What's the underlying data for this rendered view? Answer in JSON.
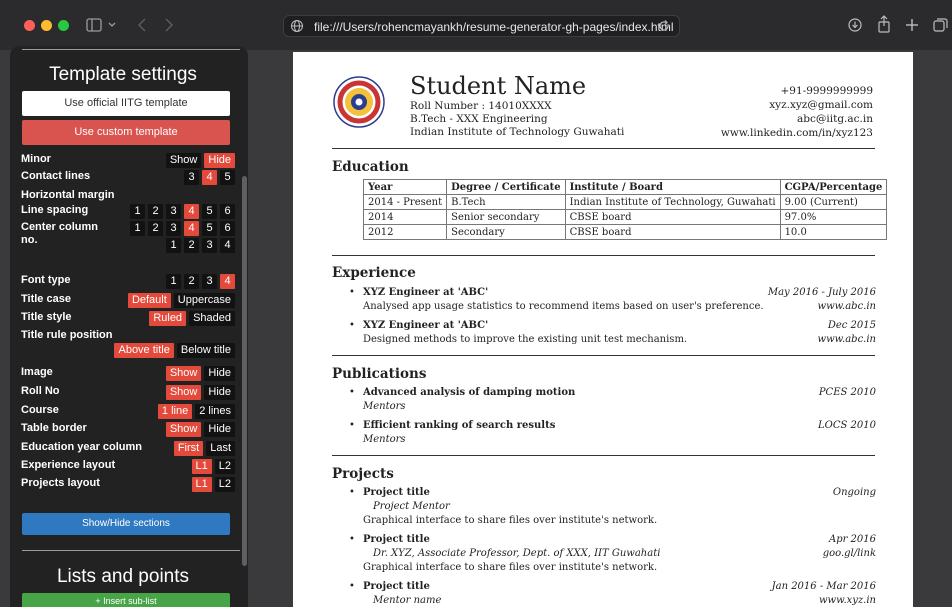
{
  "browser": {
    "url": "file:///Users/rohencmayankh/resume-generator-gh-pages/index.html"
  },
  "sidebar": {
    "template_settings_title": "Template settings",
    "official_btn": "Use official IITG template",
    "custom_btn": "Use custom template",
    "options": [
      {
        "label": "Minor",
        "choices": [
          "Show",
          "Hide"
        ],
        "selected": 1
      },
      {
        "label": "Contact lines",
        "choices": [
          "3",
          "4",
          "5"
        ],
        "selected": 1
      },
      {
        "label": "Horizontal margin",
        "choices": [],
        "selected": -1
      },
      {
        "label": "Line spacing",
        "choices": [
          "1",
          "2",
          "3",
          "4",
          "5",
          "6"
        ],
        "selected": 3
      },
      {
        "label": "Center column no.",
        "choices": [
          "1",
          "2",
          "3",
          "4",
          "5",
          "6"
        ],
        "selected": 3,
        "wrap": true
      },
      {
        "label": "",
        "choices": [
          "1",
          "2",
          "3",
          "4"
        ],
        "selected": -1
      },
      {
        "label": "Font type",
        "choices": [
          "1",
          "2",
          "3",
          "4"
        ],
        "selected": 3
      },
      {
        "label": "Title case",
        "choices": [
          "Default",
          "Uppercase"
        ],
        "selected": 0
      },
      {
        "label": "Title style",
        "choices": [
          "Ruled",
          "Shaded"
        ],
        "selected": 0
      },
      {
        "label": "Title rule position",
        "choices": [],
        "selected": -1
      },
      {
        "label": "",
        "choices": [
          "Above title",
          "Below title"
        ],
        "selected": 0
      },
      {
        "label": "Image",
        "choices": [
          "Show",
          "Hide"
        ],
        "selected": 0
      },
      {
        "label": "Roll No",
        "choices": [
          "Show",
          "Hide"
        ],
        "selected": 0
      },
      {
        "label": "Course",
        "choices": [
          "1 line",
          "2 lines"
        ],
        "selected": 0
      },
      {
        "label": "Table border",
        "choices": [
          "Show",
          "Hide"
        ],
        "selected": 0
      },
      {
        "label": "Education year column",
        "choices": [
          "First",
          "Last"
        ],
        "selected": 0
      },
      {
        "label": "Experience layout",
        "choices": [
          "L1",
          "L2"
        ],
        "selected": 0
      },
      {
        "label": "Projects layout",
        "choices": [
          "L1",
          "L2"
        ],
        "selected": 0
      }
    ],
    "show_hide_btn": "Show/Hide sections",
    "lists_title": "Lists and points",
    "insert_btn": "+ Insert sub-list",
    "accent_color": "#e34a3b"
  },
  "resume": {
    "name": "Student Name",
    "roll": "Roll Number : 14010XXXX",
    "course": "B.Tech - XXX Engineering",
    "institute": "Indian Institute of Technology Guwahati",
    "phone": "+91-9999999999",
    "email1": "xyz.xyz@gmail.com",
    "email2": "abc@iitg.ac.in",
    "linkedin": "www.linkedin.com/in/xyz123",
    "education": {
      "title": "Education",
      "headers": [
        "Year",
        "Degree / Certificate",
        "Institute / Board",
        "CGPA/Percentage"
      ],
      "rows": [
        [
          "2014 - Present",
          "B.Tech",
          "Indian Institute of Technology, Guwahati",
          "9.00 (Current)"
        ],
        [
          "2014",
          "Senior secondary",
          "CBSE board",
          "97.0%"
        ],
        [
          "2012",
          "Secondary",
          "CBSE board",
          "10.0"
        ]
      ]
    },
    "experience": {
      "title": "Experience",
      "items": [
        {
          "title": "XYZ Engineer at 'ABC'",
          "date": "May 2016 - July 2016",
          "desc": "Analysed app usage statistics to recommend items based on user's preference.",
          "link": "www.abc.in"
        },
        {
          "title": "XYZ Engineer at 'ABC'",
          "date": "Dec 2015",
          "desc": "Designed methods to improve the existing unit test mechanism.",
          "link": "www.abc.in"
        }
      ]
    },
    "publications": {
      "title": "Publications",
      "items": [
        {
          "title": "Advanced analysis of damping motion",
          "venue": "PCES 2010",
          "authors": "Mentors"
        },
        {
          "title": "Efficient ranking of search results",
          "venue": "LOCS 2010",
          "authors": "Mentors"
        }
      ]
    },
    "projects": {
      "title": "Projects",
      "items": [
        {
          "title": "Project title",
          "date": "Ongoing",
          "mentor": "Project Mentor",
          "link": "",
          "desc": "Graphical interface to share files over institute's network."
        },
        {
          "title": "Project title",
          "date": "Apr 2016",
          "mentor": "Dr. XYZ, Associate Professor, Dept. of XXX, IIT Guwahati",
          "link": "goo.gl/link",
          "desc": "Graphical interface to share files over institute's network."
        },
        {
          "title": "Project title",
          "date": "Jan 2016 - Mar 2016",
          "mentor": "Mentor name",
          "link": "www.xyz.in",
          "desc": ""
        }
      ]
    }
  }
}
